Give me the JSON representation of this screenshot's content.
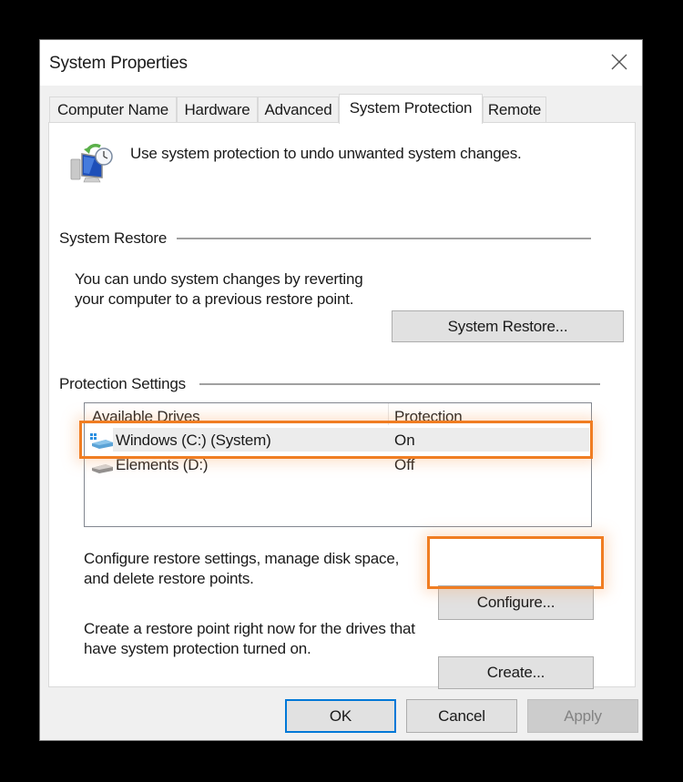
{
  "window": {
    "title": "System Properties",
    "close_icon": "close-icon"
  },
  "tabs": [
    {
      "label": "Computer Name",
      "selected": false
    },
    {
      "label": "Hardware",
      "selected": false
    },
    {
      "label": "Advanced",
      "selected": false
    },
    {
      "label": "System Protection",
      "selected": true
    },
    {
      "label": "Remote",
      "selected": false
    }
  ],
  "intro": {
    "icon": "system-restore-icon",
    "text": "Use system protection to undo unwanted system changes."
  },
  "system_restore": {
    "group_label": "System Restore",
    "description_line1": "You can undo system changes by reverting",
    "description_line2": "your computer to a previous restore point.",
    "button_label": "System Restore..."
  },
  "protection_settings": {
    "group_label": "Protection Settings",
    "columns": [
      "Available Drives",
      "Protection"
    ],
    "drives": [
      {
        "name": "Windows (C:) (System)",
        "protection": "On",
        "icon": "windows-drive-icon",
        "selected": true
      },
      {
        "name": "Elements (D:)",
        "protection": "Off",
        "icon": "external-drive-icon",
        "selected": false
      }
    ],
    "configure": {
      "description_line1": "Configure restore settings, manage disk space,",
      "description_line2": "and delete restore points.",
      "button_label": "Configure..."
    },
    "create": {
      "description_line1": "Create a restore point right now for the drives that",
      "description_line2": "have system protection turned on.",
      "button_label": "Create..."
    }
  },
  "footer": {
    "ok_label": "OK",
    "cancel_label": "Cancel",
    "apply_label": "Apply"
  },
  "annotations": {
    "highlight_color": "#f07d22",
    "highlighted": [
      "Windows (C:) (System) row",
      "Configure... button"
    ]
  }
}
